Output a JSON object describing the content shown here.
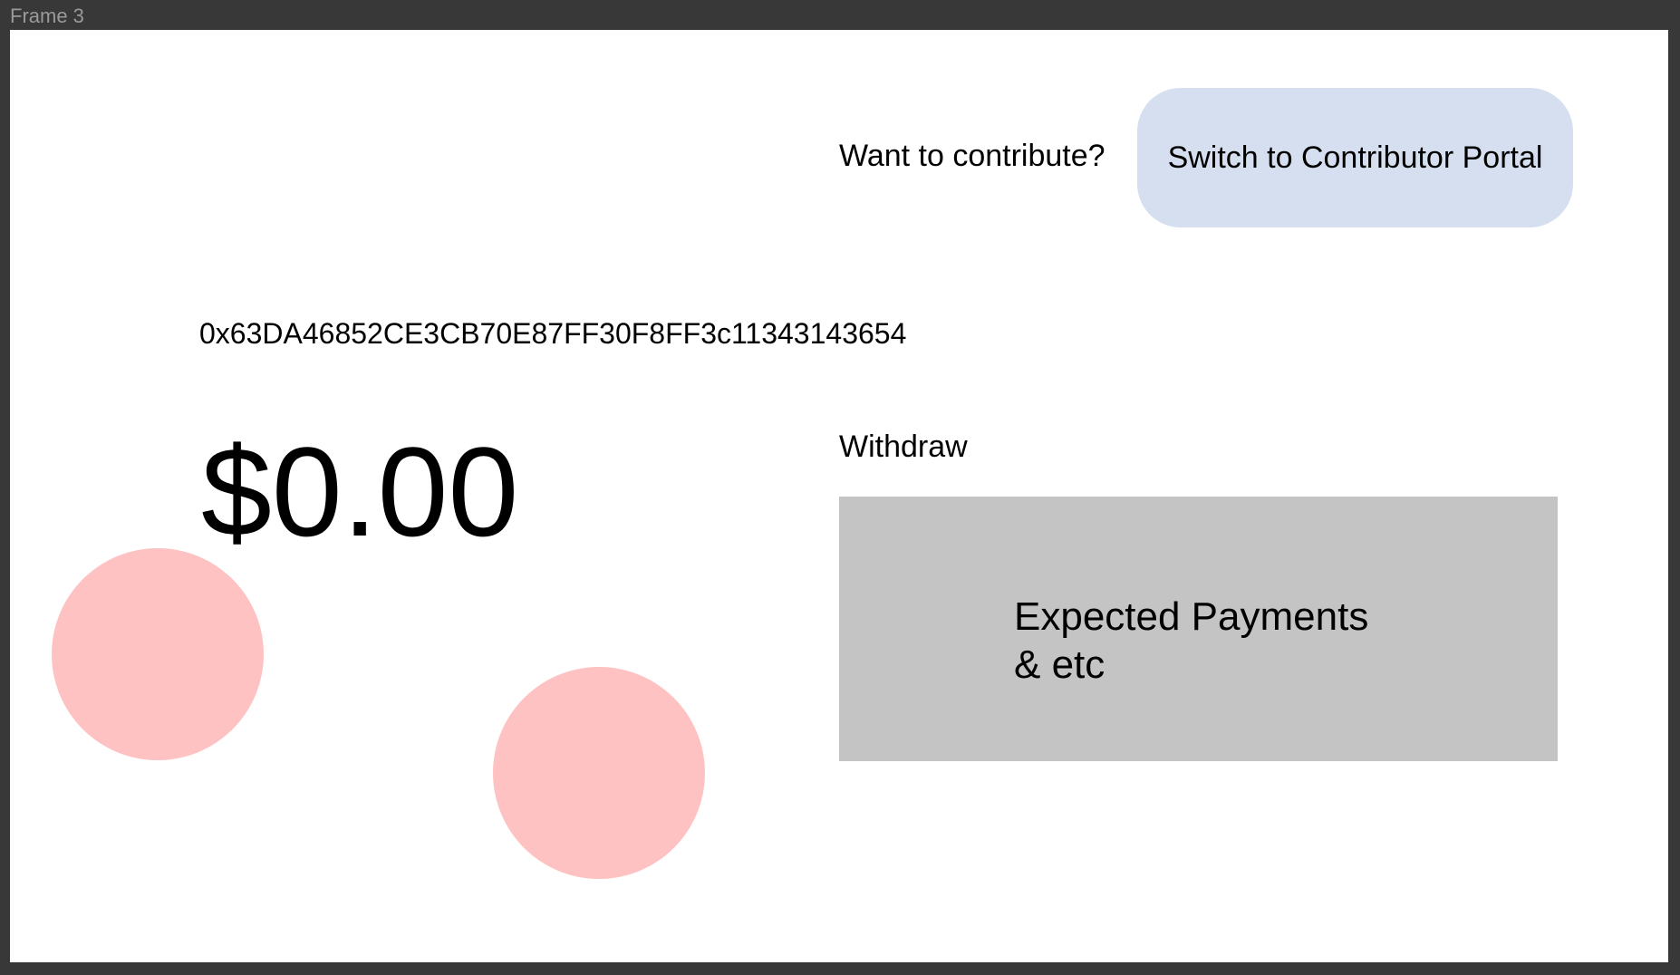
{
  "frame": {
    "label": "Frame 3"
  },
  "header": {
    "prompt": "Want to contribute?",
    "switch_button_label": "Switch to Contributor Portal"
  },
  "wallet": {
    "address": "0x63DA46852CE3CB70E87FF30F8FF3c11343143654",
    "balance": "$0.00"
  },
  "actions": {
    "withdraw_label": "Withdraw"
  },
  "payments_panel": {
    "text": "Expected Payments\n& etc"
  },
  "colors": {
    "frame_background": "#383838",
    "canvas_background": "#ffffff",
    "switch_button": "#d5dff0",
    "payments_panel": "#c4c4c4",
    "circle": "#ffc2c2"
  }
}
